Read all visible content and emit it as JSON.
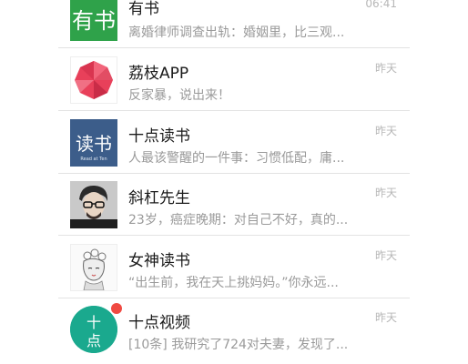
{
  "chats": [
    {
      "name": "有书",
      "preview": "离婚律师调查出轨：婚姻里，比三观...",
      "time": "06:41",
      "avatar_icon": "youshu-logo",
      "color": "#2fa24a"
    },
    {
      "name": "荔枝APP",
      "preview": "反家暴，说出来！",
      "time": "昨天",
      "avatar_icon": "lychee-logo",
      "color": "#e8405a"
    },
    {
      "name": "十点读书",
      "preview": "人最该警醒的一件事：习惯低配，庸...",
      "time": "昨天",
      "avatar_icon": "shidian-dushu-logo",
      "avatar_text": "读书",
      "avatar_subtext": "Read at Ten",
      "color": "#3c5d8a"
    },
    {
      "name": "斜杠先生",
      "preview": "23岁，癌症晚期：对自己不好，真的...",
      "time": "昨天",
      "avatar_icon": "man-with-glasses-avatar"
    },
    {
      "name": "女神读书",
      "preview": "“出生前，我在天上挑妈妈。”你永远...",
      "time": "昨天",
      "avatar_icon": "woman-sketch-avatar"
    },
    {
      "name": "十点视频",
      "preview": "[10条] 我研究了724对夫妻，发现了...",
      "time": "昨天",
      "avatar_icon": "shidian-video-logo",
      "avatar_text_1": "十",
      "avatar_text_2": "点",
      "color": "#1aa98e",
      "unread_dot": true,
      "badge_color": "#f04a42"
    }
  ]
}
